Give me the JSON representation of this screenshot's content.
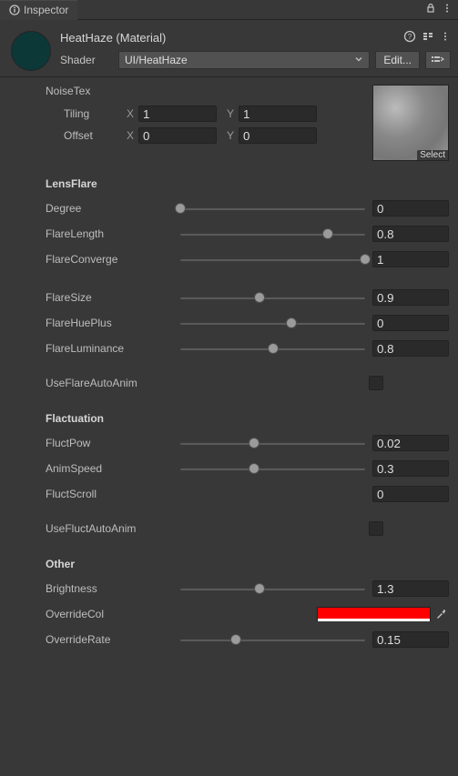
{
  "titlebar": {
    "tab_label": "Inspector",
    "info_icon": "info-icon",
    "lock_icon": "lock-icon",
    "more_icon": "more-icon"
  },
  "header": {
    "material_name": "HeatHaze (Material)",
    "shader_label": "Shader",
    "shader_value": "UI/HeatHaze",
    "edit_label": "Edit...",
    "help_icon": "help-icon",
    "presets_icon": "presets-icon",
    "more_icon": "more-icon",
    "queue_icon": "queue-icon"
  },
  "noise": {
    "label": "NoiseTex",
    "tiling_label": "Tiling",
    "offset_label": "Offset",
    "x_label": "X",
    "y_label": "Y",
    "tiling_x": "1",
    "tiling_y": "1",
    "offset_x": "0",
    "offset_y": "0",
    "select_label": "Select"
  },
  "sections": {
    "lensflare": "LensFlare",
    "flactuation": "Flactuation",
    "other": "Other"
  },
  "lensflare": {
    "degree_label": "Degree",
    "degree_value": "0",
    "degree_pct": 0,
    "flarelength_label": "FlareLength",
    "flarelength_value": "0.8",
    "flarelength_pct": 80,
    "flareconverge_label": "FlareConverge",
    "flareconverge_value": "1",
    "flareconverge_pct": 100,
    "flaresize_label": "FlareSize",
    "flaresize_value": "0.9",
    "flaresize_pct": 43,
    "flarehueplus_label": "FlareHuePlus",
    "flarehueplus_value": "0",
    "flarehueplus_pct": 60,
    "flareluminance_label": "FlareLuminance",
    "flareluminance_value": "0.8",
    "flareluminance_pct": 50,
    "useflareautoanim_label": "UseFlareAutoAnim"
  },
  "flactuation": {
    "fluctpow_label": "FluctPow",
    "fluctpow_value": "0.02",
    "fluctpow_pct": 40,
    "animspeed_label": "AnimSpeed",
    "animspeed_value": "0.3",
    "animspeed_pct": 40,
    "fluctscroll_label": "FluctScroll",
    "fluctscroll_value": "0",
    "usefluctautoanim_label": "UseFluctAutoAnim"
  },
  "other": {
    "brightness_label": "Brightness",
    "brightness_value": "1.3",
    "brightness_pct": 43,
    "overridecol_label": "OverrideCol",
    "overridecol_color": "#ff0000",
    "overriderate_label": "OverrideRate",
    "overriderate_value": "0.15",
    "overriderate_pct": 30
  }
}
